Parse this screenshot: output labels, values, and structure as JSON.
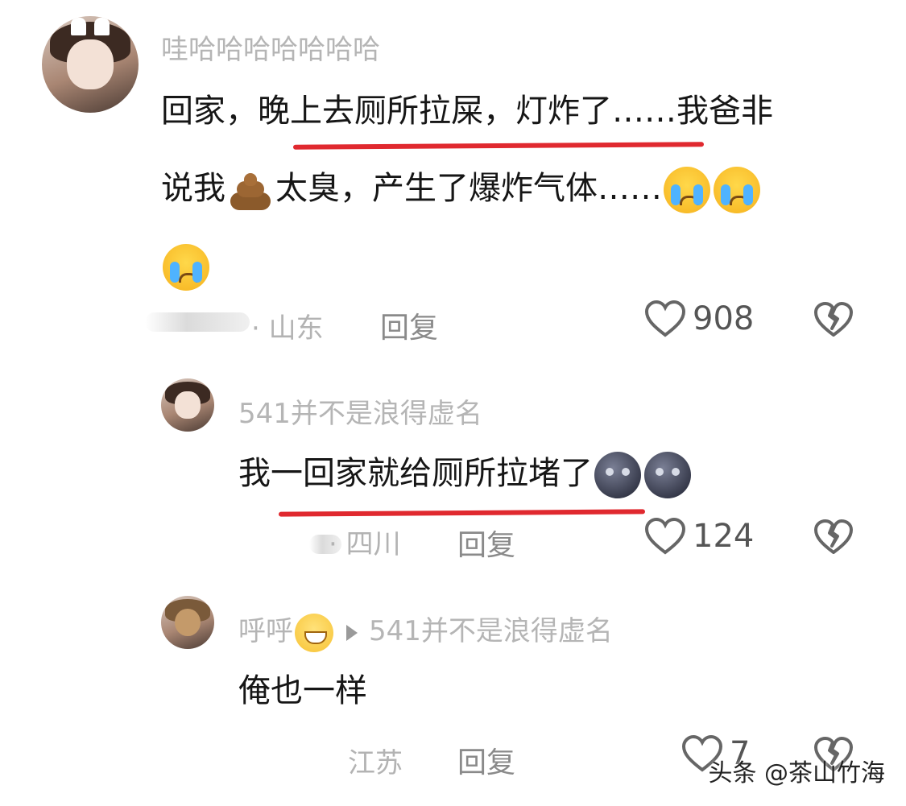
{
  "comments": [
    {
      "username": "哇哈哈哈哈哈哈哈",
      "text_line1": "回家，晚上去厕所拉屎，灯炸了……我爸非",
      "text_line2a": "说我",
      "text_line2b": "太臭，产生了爆炸气体……",
      "location": "· 山东",
      "reply_label": "回复",
      "likes": "908"
    },
    {
      "username": "541并不是浪得虚名",
      "text": "我一回家就给厕所拉堵了",
      "location": "· 四川",
      "reply_label": "回复",
      "likes": "124"
    },
    {
      "username": "呼呼",
      "reply_to": "541并不是浪得虚名",
      "text": "俺也一样",
      "location": "江苏",
      "reply_label": "回复",
      "likes": "7"
    }
  ],
  "watermark": "头条 @茶山竹海",
  "colors": {
    "underline": "#e0292f",
    "meta": "#b3b3b3"
  },
  "icons": [
    "heart-icon",
    "broken-heart-icon",
    "loudly-crying-face-emoji",
    "pile-of-poo-emoji",
    "new-moon-face-emoji",
    "grinning-face-emoji"
  ]
}
